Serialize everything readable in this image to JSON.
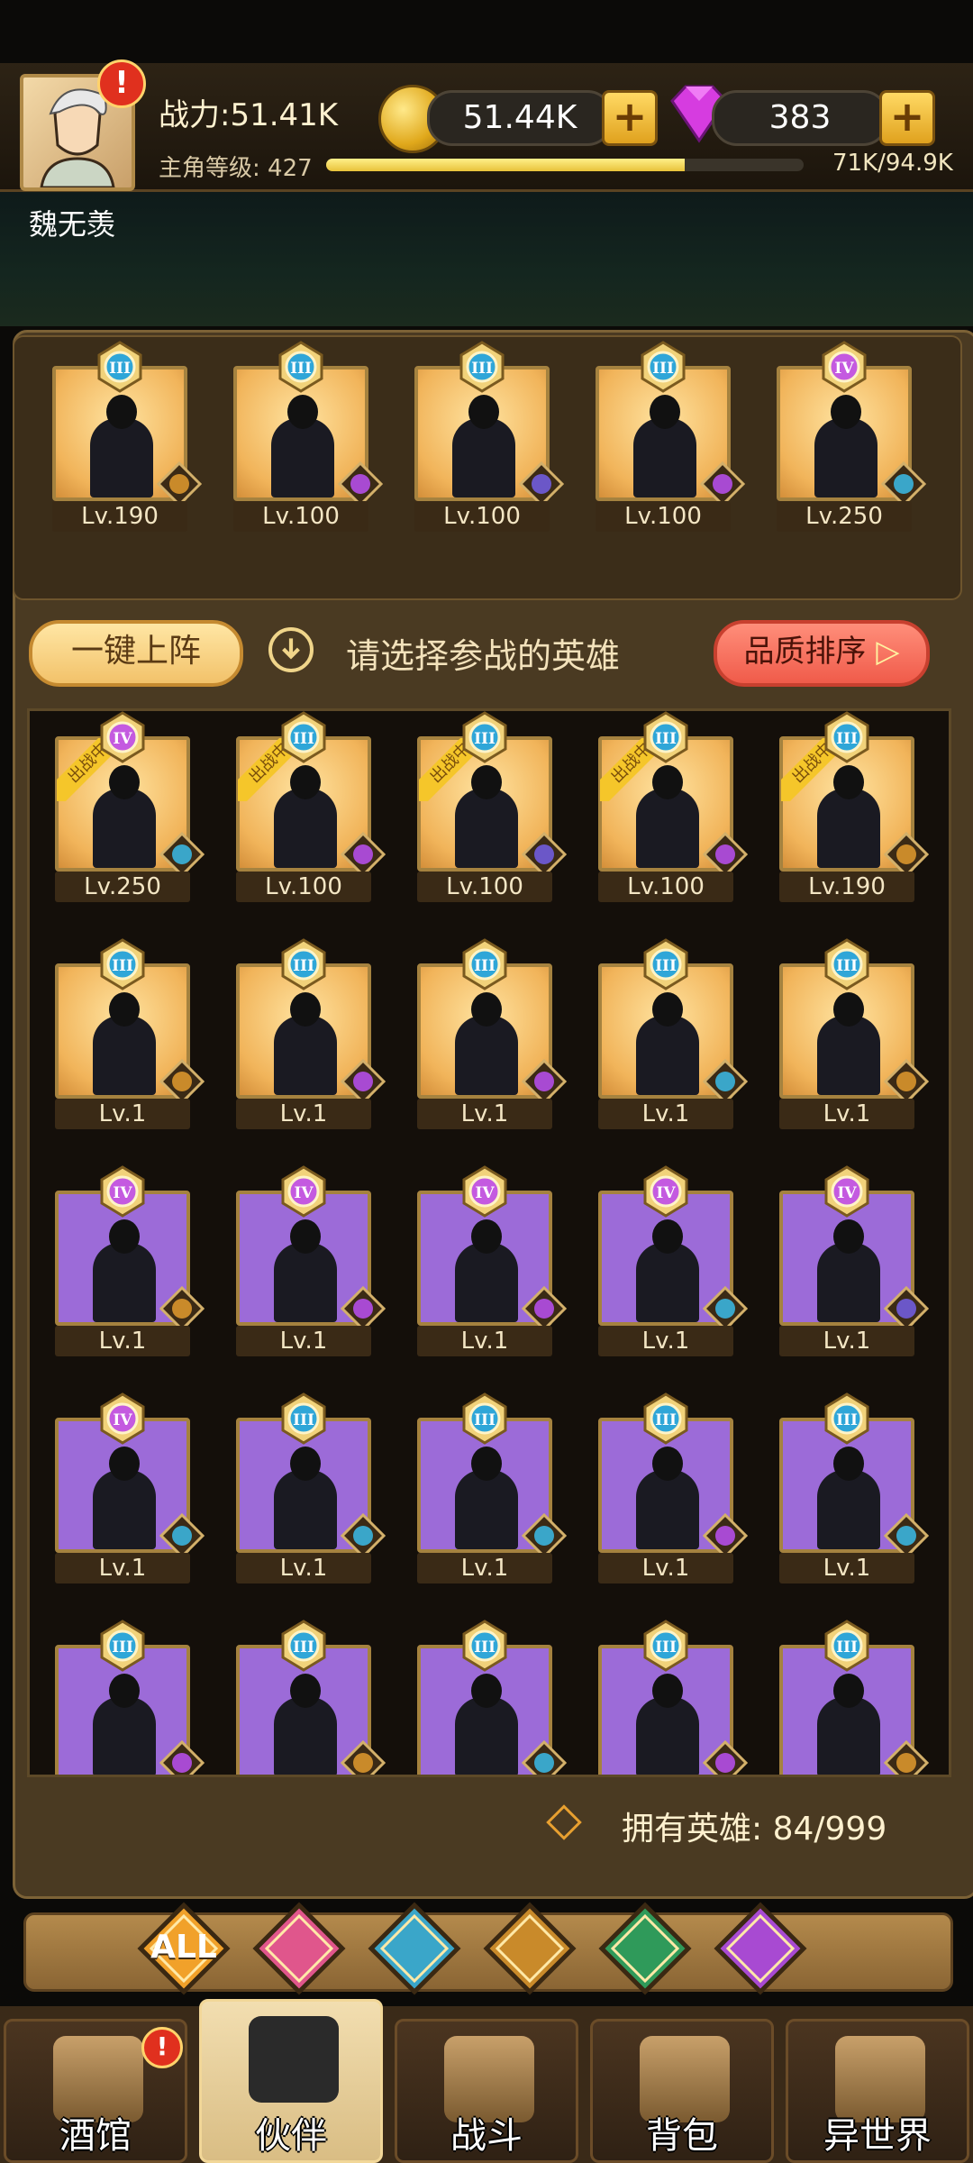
{
  "player": {
    "power": "战力:51.41K",
    "gold": "51.44K",
    "gems": "383",
    "level_label": "主角等级: 427",
    "xp": "71K/94.9K",
    "xp_fraction": 0.75,
    "name": "魏无羡"
  },
  "team": [
    {
      "rank": "III",
      "level": "Lv.190",
      "bg": "gold",
      "faction": "lion-icon"
    },
    {
      "rank": "III",
      "level": "Lv.100",
      "bg": "gold",
      "faction": "demon-icon"
    },
    {
      "rank": "III",
      "level": "Lv.100",
      "bg": "gold",
      "faction": "crown-icon"
    },
    {
      "rank": "III",
      "level": "Lv.100",
      "bg": "gold",
      "faction": "demon-icon"
    },
    {
      "rank": "IV",
      "level": "Lv.250",
      "bg": "gold",
      "faction": "elf-icon"
    }
  ],
  "controls": {
    "onekey": "一键上阵",
    "hint": "请选择参战的英雄",
    "sort": "品质排序"
  },
  "in_battle_label": "出战中",
  "heroes": [
    {
      "rank": "IV",
      "level": "Lv.250",
      "bg": "gold",
      "faction": "elf-icon",
      "in_battle": true
    },
    {
      "rank": "III",
      "level": "Lv.100",
      "bg": "gold",
      "faction": "demon-icon",
      "in_battle": true
    },
    {
      "rank": "III",
      "level": "Lv.100",
      "bg": "gold",
      "faction": "crown-icon",
      "in_battle": true
    },
    {
      "rank": "III",
      "level": "Lv.100",
      "bg": "gold",
      "faction": "demon-icon",
      "in_battle": true
    },
    {
      "rank": "III",
      "level": "Lv.190",
      "bg": "gold",
      "faction": "lion-icon",
      "in_battle": true
    },
    {
      "rank": "III",
      "level": "Lv.1",
      "bg": "gold",
      "faction": "lion-icon"
    },
    {
      "rank": "III",
      "level": "Lv.1",
      "bg": "gold",
      "faction": "demon-icon"
    },
    {
      "rank": "III",
      "level": "Lv.1",
      "bg": "gold",
      "faction": "demon-icon"
    },
    {
      "rank": "III",
      "level": "Lv.1",
      "bg": "gold",
      "faction": "elf-icon"
    },
    {
      "rank": "III",
      "level": "Lv.1",
      "bg": "gold",
      "faction": "lion-icon"
    },
    {
      "rank": "IV",
      "level": "Lv.1",
      "bg": "purple",
      "faction": "lion-icon"
    },
    {
      "rank": "IV",
      "level": "Lv.1",
      "bg": "purple",
      "faction": "demon-icon"
    },
    {
      "rank": "IV",
      "level": "Lv.1",
      "bg": "purple",
      "faction": "demon-icon"
    },
    {
      "rank": "IV",
      "level": "Lv.1",
      "bg": "purple",
      "faction": "elf-icon"
    },
    {
      "rank": "IV",
      "level": "Lv.1",
      "bg": "purple",
      "faction": "crown-icon"
    },
    {
      "rank": "IV",
      "level": "Lv.1",
      "bg": "purple",
      "faction": "elf-icon"
    },
    {
      "rank": "III",
      "level": "Lv.1",
      "bg": "purple",
      "faction": "elf-icon"
    },
    {
      "rank": "III",
      "level": "Lv.1",
      "bg": "purple",
      "faction": "elf-icon"
    },
    {
      "rank": "III",
      "level": "Lv.1",
      "bg": "purple",
      "faction": "demon-icon"
    },
    {
      "rank": "III",
      "level": "Lv.1",
      "bg": "purple",
      "faction": "elf-icon"
    },
    {
      "rank": "III",
      "level": "",
      "bg": "purple",
      "faction": "demon-icon"
    },
    {
      "rank": "III",
      "level": "",
      "bg": "purple",
      "faction": "lion-icon"
    },
    {
      "rank": "III",
      "level": "",
      "bg": "purple",
      "faction": "elf-icon"
    },
    {
      "rank": "III",
      "level": "",
      "bg": "purple",
      "faction": "demon-icon"
    },
    {
      "rank": "III",
      "level": "",
      "bg": "purple",
      "faction": "lion-icon"
    }
  ],
  "owned": "拥有英雄: 84/999",
  "filters": [
    {
      "label": "ALL",
      "icon": "all-icon",
      "color": "#f1a12a"
    },
    {
      "label": "",
      "icon": "crown-icon",
      "color": "#e0568c"
    },
    {
      "label": "",
      "icon": "elf-icon",
      "color": "#3aa6c9"
    },
    {
      "label": "",
      "icon": "lion-icon",
      "color": "#c98a2a"
    },
    {
      "label": "",
      "icon": "nature-icon",
      "color": "#2f9a5a"
    },
    {
      "label": "",
      "icon": "demon-icon",
      "color": "#a84ad2"
    }
  ],
  "nav": [
    {
      "label": "酒馆",
      "icon": "tavern-mug-icon",
      "alert": "!"
    },
    {
      "label": "伙伴",
      "icon": "partner-icon",
      "active": true
    },
    {
      "label": "战斗",
      "icon": "battle-swords-icon"
    },
    {
      "label": "背包",
      "icon": "backpack-icon"
    },
    {
      "label": "异世界",
      "icon": "portal-icon"
    }
  ],
  "avatar_alert": "!",
  "colors": {
    "gold_frame": "#a5823f",
    "purple_card": "#9c6bd8",
    "gold_card": "#f1b45a"
  }
}
